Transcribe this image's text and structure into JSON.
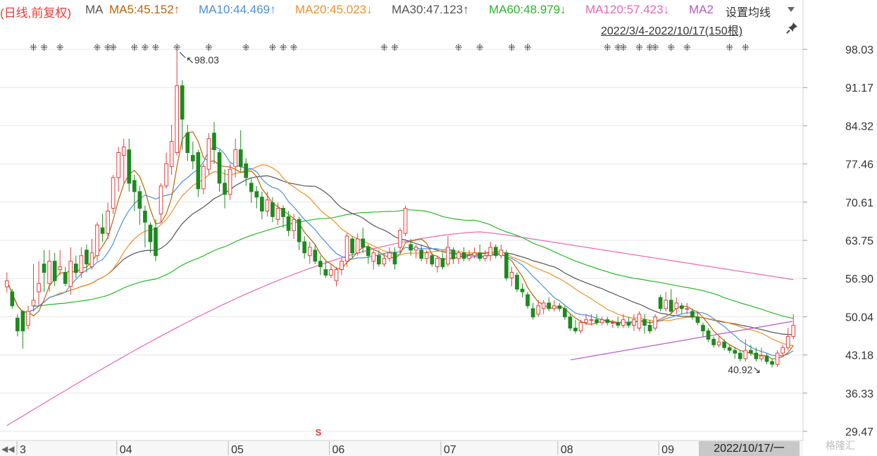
{
  "header": {
    "mode_label": "(日线,前复权)",
    "ma_label": "MA",
    "ma_items": [
      {
        "label": "MA5:45.152↑",
        "color": "#b8660b"
      },
      {
        "label": "MA10:44.469↑",
        "color": "#4f8fd9"
      },
      {
        "label": "MA20:45.023↓",
        "color": "#f0902a"
      },
      {
        "label": "MA30:47.123↑",
        "color": "#555555"
      },
      {
        "label": "MA60:48.979↓",
        "color": "#2db52d"
      },
      {
        "label": "MA120:57.423↓",
        "color": "#e867b3"
      },
      {
        "label": "MA2",
        "color": "#b35ac8"
      }
    ],
    "settings_label": "设置均线",
    "range_label": "2022/3/4-2022/10/17(150根)"
  },
  "footer": {
    "date_badge": "2022/10/17/一",
    "watermark": "格隆汇"
  },
  "colors": {
    "up": "#e0403c",
    "down": "#1d8a1d",
    "ma5": "#b8660b",
    "ma10": "#4f8fd9",
    "ma20": "#f0902a",
    "ma30": "#555555",
    "ma60": "#2db52d",
    "ma120": "#e867b3",
    "trend": "#b35ac8",
    "grid": "#e6e6e6"
  },
  "chart_data": {
    "type": "candlestick",
    "date_range": [
      "2022/3/4",
      "2022/10/17"
    ],
    "bar_count": 150,
    "y_ticks": [
      98.03,
      91.17,
      84.32,
      77.46,
      70.61,
      63.75,
      56.9,
      50.04,
      43.18,
      36.33,
      29.47
    ],
    "ylim": [
      29.47,
      98.03
    ],
    "x_tick_labels": [
      "3",
      "04",
      "05",
      "06",
      "07",
      "08",
      "09"
    ],
    "annotations": {
      "high": "98.03",
      "low": "40.92",
      "event_marker": "S"
    },
    "candles": [
      {
        "d": "3",
        "o": 55.4,
        "c": 56.5,
        "h": 58.0,
        "l": 54.4
      },
      {
        "d": "3",
        "o": 54.5,
        "c": 52.0,
        "h": 55.0,
        "l": 51.5
      },
      {
        "d": "3",
        "o": 49.8,
        "c": 47.5,
        "h": 50.5,
        "l": 46.5
      },
      {
        "d": "3",
        "o": 51.0,
        "c": 47.5,
        "h": 51.2,
        "l": 44.3
      },
      {
        "d": "3",
        "o": 48.5,
        "c": 51.0,
        "h": 52.0,
        "l": 47.8
      },
      {
        "d": "3",
        "o": 52.0,
        "c": 53.0,
        "h": 59.5,
        "l": 51.0
      },
      {
        "d": "3",
        "o": 54.5,
        "c": 56.0,
        "h": 60.0,
        "l": 52.0
      },
      {
        "d": "3",
        "o": 59.5,
        "c": 58.0,
        "h": 62.0,
        "l": 54.5
      },
      {
        "d": "3",
        "o": 56.0,
        "c": 60.0,
        "h": 62.0,
        "l": 54.5
      },
      {
        "d": "3",
        "o": 60.0,
        "c": 56.5,
        "h": 61.5,
        "l": 55.5
      },
      {
        "d": "3",
        "o": 58.5,
        "c": 59.0,
        "h": 62.0,
        "l": 57.5
      },
      {
        "d": "3",
        "o": 58.0,
        "c": 56.0,
        "h": 59.0,
        "l": 55.5
      },
      {
        "d": "3",
        "o": 55.5,
        "c": 60.0,
        "h": 62.5,
        "l": 54.0
      },
      {
        "d": "3",
        "o": 59.5,
        "c": 58.0,
        "h": 61.0,
        "l": 57.0
      },
      {
        "d": "3",
        "o": 58.0,
        "c": 61.0,
        "h": 62.5,
        "l": 57.0
      },
      {
        "d": "3",
        "o": 62.0,
        "c": 59.5,
        "h": 63.0,
        "l": 58.0
      },
      {
        "d": "3",
        "o": 59.0,
        "c": 61.5,
        "h": 64.0,
        "l": 58.5
      },
      {
        "d": "3",
        "o": 61.0,
        "c": 66.5,
        "h": 67.0,
        "l": 60.0
      },
      {
        "d": "3",
        "o": 66.0,
        "c": 65.0,
        "h": 68.5,
        "l": 63.5
      },
      {
        "d": "3",
        "o": 65.0,
        "c": 69.0,
        "h": 70.5,
        "l": 64.0
      },
      {
        "d": "3",
        "o": 69.5,
        "c": 75.0,
        "h": 75.5,
        "l": 68.5
      },
      {
        "d": "3",
        "o": 75.0,
        "c": 79.5,
        "h": 80.5,
        "l": 72.5
      },
      {
        "d": "04",
        "o": 79.0,
        "c": 80.5,
        "h": 82.0,
        "l": 74.0
      },
      {
        "d": "04",
        "o": 80.0,
        "c": 74.0,
        "h": 82.0,
        "l": 72.5
      },
      {
        "d": "04",
        "o": 74.5,
        "c": 72.5,
        "h": 75.5,
        "l": 69.0
      },
      {
        "d": "04",
        "o": 72.5,
        "c": 69.5,
        "h": 73.5,
        "l": 66.5
      },
      {
        "d": "04",
        "o": 69.0,
        "c": 67.0,
        "h": 70.0,
        "l": 62.5
      },
      {
        "d": "04",
        "o": 66.5,
        "c": 63.5,
        "h": 67.0,
        "l": 61.5
      },
      {
        "d": "04",
        "o": 66.0,
        "c": 61.0,
        "h": 67.5,
        "l": 60.0
      },
      {
        "d": "04",
        "o": 68.5,
        "c": 73.5,
        "h": 74.0,
        "l": 67.0
      },
      {
        "d": "04",
        "o": 73.5,
        "c": 77.5,
        "h": 79.5,
        "l": 73.0
      },
      {
        "d": "04",
        "o": 77.0,
        "c": 81.5,
        "h": 84.5,
        "l": 75.5
      },
      {
        "d": "04",
        "o": 79.5,
        "c": 91.5,
        "h": 98.03,
        "l": 79.0
      },
      {
        "d": "04",
        "o": 91.5,
        "c": 85.5,
        "h": 92.5,
        "l": 80.0
      },
      {
        "d": "04",
        "o": 83.0,
        "c": 79.5,
        "h": 84.5,
        "l": 78.0
      },
      {
        "d": "04",
        "o": 79.0,
        "c": 78.0,
        "h": 81.5,
        "l": 76.5
      },
      {
        "d": "04",
        "o": 79.5,
        "c": 73.0,
        "h": 80.0,
        "l": 71.5
      },
      {
        "d": "04",
        "o": 73.0,
        "c": 77.0,
        "h": 77.5,
        "l": 72.0
      },
      {
        "d": "04",
        "o": 76.5,
        "c": 82.0,
        "h": 83.0,
        "l": 75.5
      },
      {
        "d": "04",
        "o": 83.0,
        "c": 80.0,
        "h": 85.0,
        "l": 77.5
      },
      {
        "d": "04",
        "o": 79.5,
        "c": 74.0,
        "h": 80.0,
        "l": 72.5
      },
      {
        "d": "04",
        "o": 74.0,
        "c": 72.0,
        "h": 76.5,
        "l": 69.5
      },
      {
        "d": "04",
        "o": 72.0,
        "c": 76.5,
        "h": 77.5,
        "l": 71.0
      },
      {
        "d": "05",
        "o": 77.0,
        "c": 80.0,
        "h": 82.0,
        "l": 75.0
      },
      {
        "d": "05",
        "o": 80.0,
        "c": 77.0,
        "h": 83.5,
        "l": 76.0
      },
      {
        "d": "05",
        "o": 77.5,
        "c": 75.0,
        "h": 78.5,
        "l": 73.5
      },
      {
        "d": "05",
        "o": 74.0,
        "c": 72.5,
        "h": 75.0,
        "l": 70.5
      },
      {
        "d": "05",
        "o": 72.5,
        "c": 71.5,
        "h": 73.5,
        "l": 69.5
      },
      {
        "d": "05",
        "o": 71.5,
        "c": 69.0,
        "h": 72.5,
        "l": 67.5
      },
      {
        "d": "05",
        "o": 69.0,
        "c": 71.0,
        "h": 72.5,
        "l": 68.0
      },
      {
        "d": "05",
        "o": 70.5,
        "c": 68.0,
        "h": 71.5,
        "l": 67.0
      },
      {
        "d": "05",
        "o": 67.5,
        "c": 69.5,
        "h": 70.5,
        "l": 66.5
      },
      {
        "d": "05",
        "o": 69.5,
        "c": 68.0,
        "h": 70.0,
        "l": 66.0
      },
      {
        "d": "05",
        "o": 68.0,
        "c": 65.5,
        "h": 69.0,
        "l": 64.5
      },
      {
        "d": "05",
        "o": 65.5,
        "c": 67.5,
        "h": 68.5,
        "l": 64.0
      },
      {
        "d": "05",
        "o": 67.5,
        "c": 63.5,
        "h": 68.0,
        "l": 62.0
      },
      {
        "d": "05",
        "o": 63.5,
        "c": 61.5,
        "h": 64.5,
        "l": 60.5
      },
      {
        "d": "05",
        "o": 61.0,
        "c": 62.5,
        "h": 63.5,
        "l": 59.5
      },
      {
        "d": "05",
        "o": 62.0,
        "c": 60.0,
        "h": 63.0,
        "l": 59.5
      },
      {
        "d": "05",
        "o": 60.0,
        "c": 59.0,
        "h": 61.0,
        "l": 57.5
      },
      {
        "d": "05",
        "o": 58.5,
        "c": 57.5,
        "h": 60.0,
        "l": 57.0
      },
      {
        "d": "05",
        "o": 57.5,
        "c": 58.5,
        "h": 59.5,
        "l": 57.0
      },
      {
        "d": "06",
        "o": 56.5,
        "c": 58.5,
        "h": 59.0,
        "l": 55.5
      },
      {
        "d": "06",
        "o": 58.5,
        "c": 60.0,
        "h": 60.5,
        "l": 57.5
      },
      {
        "d": "06",
        "o": 60.0,
        "c": 64.5,
        "h": 65.0,
        "l": 59.0
      },
      {
        "d": "06",
        "o": 64.0,
        "c": 61.5,
        "h": 64.5,
        "l": 60.5
      },
      {
        "d": "06",
        "o": 61.5,
        "c": 64.0,
        "h": 65.0,
        "l": 61.0
      },
      {
        "d": "06",
        "o": 64.0,
        "c": 62.5,
        "h": 66.0,
        "l": 61.5
      },
      {
        "d": "06",
        "o": 62.5,
        "c": 61.0,
        "h": 63.0,
        "l": 59.5
      },
      {
        "d": "06",
        "o": 60.0,
        "c": 61.5,
        "h": 62.0,
        "l": 58.5
      },
      {
        "d": "06",
        "o": 61.0,
        "c": 59.5,
        "h": 62.0,
        "l": 59.0
      },
      {
        "d": "06",
        "o": 59.5,
        "c": 60.5,
        "h": 61.5,
        "l": 59.0
      },
      {
        "d": "06",
        "o": 60.5,
        "c": 61.5,
        "h": 62.5,
        "l": 60.0
      },
      {
        "d": "06",
        "o": 61.5,
        "c": 59.5,
        "h": 62.5,
        "l": 58.5
      },
      {
        "d": "06",
        "o": 62.5,
        "c": 65.5,
        "h": 66.0,
        "l": 61.5
      },
      {
        "d": "06",
        "o": 65.0,
        "c": 69.5,
        "h": 70.0,
        "l": 64.5
      },
      {
        "d": "06",
        "o": 63.0,
        "c": 62.0,
        "h": 64.0,
        "l": 61.0
      },
      {
        "d": "06",
        "o": 62.0,
        "c": 62.5,
        "h": 63.0,
        "l": 60.5
      },
      {
        "d": "06",
        "o": 62.0,
        "c": 60.5,
        "h": 63.0,
        "l": 60.0
      },
      {
        "d": "06",
        "o": 60.5,
        "c": 61.5,
        "h": 62.0,
        "l": 59.5
      },
      {
        "d": "06",
        "o": 61.0,
        "c": 59.5,
        "h": 61.5,
        "l": 59.0
      },
      {
        "d": "06",
        "o": 59.0,
        "c": 60.5,
        "h": 61.0,
        "l": 58.0
      },
      {
        "d": "06",
        "o": 60.5,
        "c": 59.0,
        "h": 61.5,
        "l": 58.5
      },
      {
        "d": "07",
        "o": 59.5,
        "c": 62.5,
        "h": 64.5,
        "l": 59.0
      },
      {
        "d": "07",
        "o": 62.0,
        "c": 60.5,
        "h": 62.5,
        "l": 59.5
      },
      {
        "d": "07",
        "o": 60.5,
        "c": 61.5,
        "h": 62.0,
        "l": 59.5
      },
      {
        "d": "07",
        "o": 61.5,
        "c": 60.5,
        "h": 62.5,
        "l": 60.0
      },
      {
        "d": "07",
        "o": 60.5,
        "c": 61.0,
        "h": 62.0,
        "l": 60.0
      },
      {
        "d": "07",
        "o": 61.0,
        "c": 61.5,
        "h": 62.5,
        "l": 60.5
      },
      {
        "d": "07",
        "o": 61.5,
        "c": 60.5,
        "h": 63.0,
        "l": 60.0
      },
      {
        "d": "07",
        "o": 60.5,
        "c": 61.0,
        "h": 62.0,
        "l": 60.0
      },
      {
        "d": "07",
        "o": 61.0,
        "c": 62.5,
        "h": 63.5,
        "l": 60.0
      },
      {
        "d": "07",
        "o": 62.5,
        "c": 61.0,
        "h": 63.0,
        "l": 60.5
      },
      {
        "d": "07",
        "o": 61.0,
        "c": 62.0,
        "h": 63.0,
        "l": 60.5
      },
      {
        "d": "07",
        "o": 61.5,
        "c": 57.0,
        "h": 62.0,
        "l": 56.5
      },
      {
        "d": "07",
        "o": 57.0,
        "c": 58.0,
        "h": 59.0,
        "l": 55.5
      },
      {
        "d": "07",
        "o": 57.5,
        "c": 55.0,
        "h": 58.0,
        "l": 54.5
      },
      {
        "d": "07",
        "o": 55.0,
        "c": 54.5,
        "h": 56.0,
        "l": 53.5
      },
      {
        "d": "07",
        "o": 54.0,
        "c": 52.0,
        "h": 54.5,
        "l": 51.5
      },
      {
        "d": "07",
        "o": 51.5,
        "c": 50.0,
        "h": 52.5,
        "l": 49.5
      },
      {
        "d": "07",
        "o": 50.5,
        "c": 52.0,
        "h": 53.0,
        "l": 50.0
      },
      {
        "d": "07",
        "o": 51.5,
        "c": 52.5,
        "h": 53.0,
        "l": 50.5
      },
      {
        "d": "07",
        "o": 52.5,
        "c": 51.5,
        "h": 53.5,
        "l": 51.0
      },
      {
        "d": "07",
        "o": 51.5,
        "c": 52.0,
        "h": 53.0,
        "l": 51.0
      },
      {
        "d": "07",
        "o": 52.0,
        "c": 51.5,
        "h": 52.5,
        "l": 51.0
      },
      {
        "d": "08",
        "o": 51.5,
        "c": 50.0,
        "h": 52.0,
        "l": 49.5
      },
      {
        "d": "08",
        "o": 50.0,
        "c": 48.0,
        "h": 50.5,
        "l": 47.5
      },
      {
        "d": "08",
        "o": 48.0,
        "c": 47.5,
        "h": 49.5,
        "l": 47.0
      },
      {
        "d": "08",
        "o": 47.5,
        "c": 49.0,
        "h": 49.5,
        "l": 47.0
      },
      {
        "d": "08",
        "o": 49.0,
        "c": 49.5,
        "h": 50.5,
        "l": 48.5
      },
      {
        "d": "08",
        "o": 49.5,
        "c": 49.5,
        "h": 50.5,
        "l": 48.5
      },
      {
        "d": "08",
        "o": 49.5,
        "c": 49.0,
        "h": 50.5,
        "l": 48.5
      },
      {
        "d": "08",
        "o": 49.0,
        "c": 49.5,
        "h": 50.0,
        "l": 48.5
      },
      {
        "d": "08",
        "o": 49.5,
        "c": 49.0,
        "h": 50.0,
        "l": 48.5
      },
      {
        "d": "08",
        "o": 49.0,
        "c": 49.0,
        "h": 49.5,
        "l": 48.0
      },
      {
        "d": "08",
        "o": 49.0,
        "c": 48.5,
        "h": 50.0,
        "l": 48.0
      },
      {
        "d": "08",
        "o": 48.5,
        "c": 49.5,
        "h": 50.5,
        "l": 48.0
      },
      {
        "d": "08",
        "o": 49.0,
        "c": 48.5,
        "h": 50.0,
        "l": 48.0
      },
      {
        "d": "08",
        "o": 48.5,
        "c": 49.5,
        "h": 50.5,
        "l": 47.5
      },
      {
        "d": "08",
        "o": 48.0,
        "c": 50.5,
        "h": 51.0,
        "l": 47.5
      },
      {
        "d": "08",
        "o": 49.5,
        "c": 48.5,
        "h": 50.5,
        "l": 47.0
      },
      {
        "d": "08",
        "o": 48.5,
        "c": 47.5,
        "h": 49.5,
        "l": 47.0
      },
      {
        "d": "08",
        "o": 48.0,
        "c": 50.0,
        "h": 50.5,
        "l": 47.5
      },
      {
        "d": "08",
        "o": 53.5,
        "c": 51.5,
        "h": 54.0,
        "l": 51.0
      },
      {
        "d": "09",
        "o": 51.5,
        "c": 53.0,
        "h": 54.5,
        "l": 51.0
      },
      {
        "d": "09",
        "o": 53.0,
        "c": 51.0,
        "h": 55.0,
        "l": 50.5
      },
      {
        "d": "09",
        "o": 51.5,
        "c": 52.5,
        "h": 53.5,
        "l": 50.5
      },
      {
        "d": "09",
        "o": 52.0,
        "c": 51.5,
        "h": 52.5,
        "l": 50.5
      },
      {
        "d": "09",
        "o": 51.5,
        "c": 51.5,
        "h": 52.5,
        "l": 50.5
      },
      {
        "d": "09",
        "o": 51.0,
        "c": 50.0,
        "h": 51.5,
        "l": 49.5
      },
      {
        "d": "09",
        "o": 50.0,
        "c": 49.0,
        "h": 51.0,
        "l": 48.5
      },
      {
        "d": "09",
        "o": 48.5,
        "c": 47.5,
        "h": 49.0,
        "l": 46.5
      },
      {
        "d": "09",
        "o": 47.5,
        "c": 46.0,
        "h": 48.0,
        "l": 45.5
      },
      {
        "d": "09",
        "o": 46.0,
        "c": 45.0,
        "h": 46.5,
        "l": 44.5
      },
      {
        "d": "09",
        "o": 45.0,
        "c": 45.5,
        "h": 46.5,
        "l": 44.5
      },
      {
        "d": "09",
        "o": 45.5,
        "c": 44.5,
        "h": 46.0,
        "l": 44.0
      },
      {
        "d": "09",
        "o": 44.5,
        "c": 44.0,
        "h": 45.0,
        "l": 43.5
      },
      {
        "d": "09",
        "o": 44.0,
        "c": 43.5,
        "h": 44.5,
        "l": 42.5
      },
      {
        "d": "09",
        "o": 43.5,
        "c": 42.5,
        "h": 44.0,
        "l": 42.0
      },
      {
        "d": "09",
        "o": 42.5,
        "c": 44.0,
        "h": 46.0,
        "l": 42.0
      },
      {
        "d": "09",
        "o": 44.0,
        "c": 43.5,
        "h": 45.0,
        "l": 43.0
      },
      {
        "d": "10",
        "o": 43.5,
        "c": 42.5,
        "h": 44.5,
        "l": 42.0
      },
      {
        "d": "10",
        "o": 42.5,
        "c": 43.0,
        "h": 44.5,
        "l": 42.0
      },
      {
        "d": "10",
        "o": 43.0,
        "c": 42.0,
        "h": 43.5,
        "l": 41.5
      },
      {
        "d": "10",
        "o": 42.0,
        "c": 41.5,
        "h": 42.5,
        "l": 40.92
      },
      {
        "d": "10",
        "o": 41.5,
        "c": 43.5,
        "h": 44.0,
        "l": 41.0
      },
      {
        "d": "10",
        "o": 43.5,
        "c": 44.5,
        "h": 45.0,
        "l": 43.0
      },
      {
        "d": "10",
        "o": 44.5,
        "c": 46.5,
        "h": 48.0,
        "l": 44.0
      },
      {
        "d": "10",
        "o": 46.5,
        "c": 48.5,
        "h": 50.5,
        "l": 46.0
      }
    ]
  }
}
